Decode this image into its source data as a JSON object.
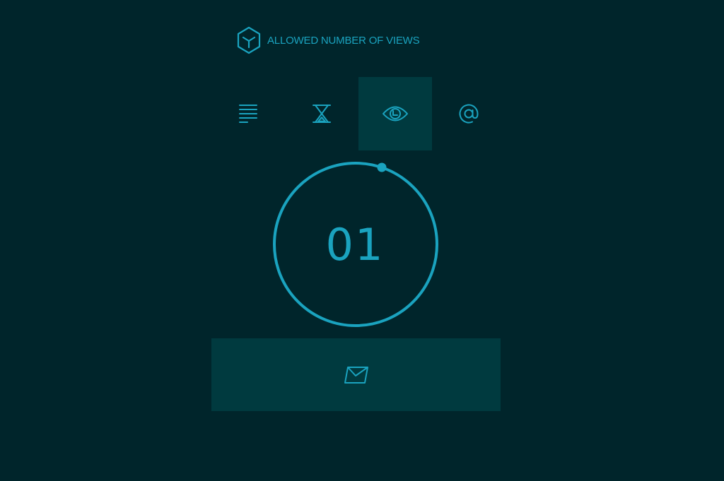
{
  "colors": {
    "background": "#00252b",
    "panel": "#003a3f",
    "accent": "#1aa3bf"
  },
  "header": {
    "logo_icon": "hexagon-cube-icon",
    "title": "ALLOWED NUMBER OF VIEWS"
  },
  "tabs": [
    {
      "icon": "lines-icon",
      "active": false
    },
    {
      "icon": "hourglass-icon",
      "active": false
    },
    {
      "icon": "eye-clock-icon",
      "active": true
    },
    {
      "icon": "at-sign-icon",
      "active": false
    }
  ],
  "counter": {
    "value": "01",
    "indicator": "dial-handle"
  },
  "send_button": {
    "icon": "envelope-icon"
  }
}
